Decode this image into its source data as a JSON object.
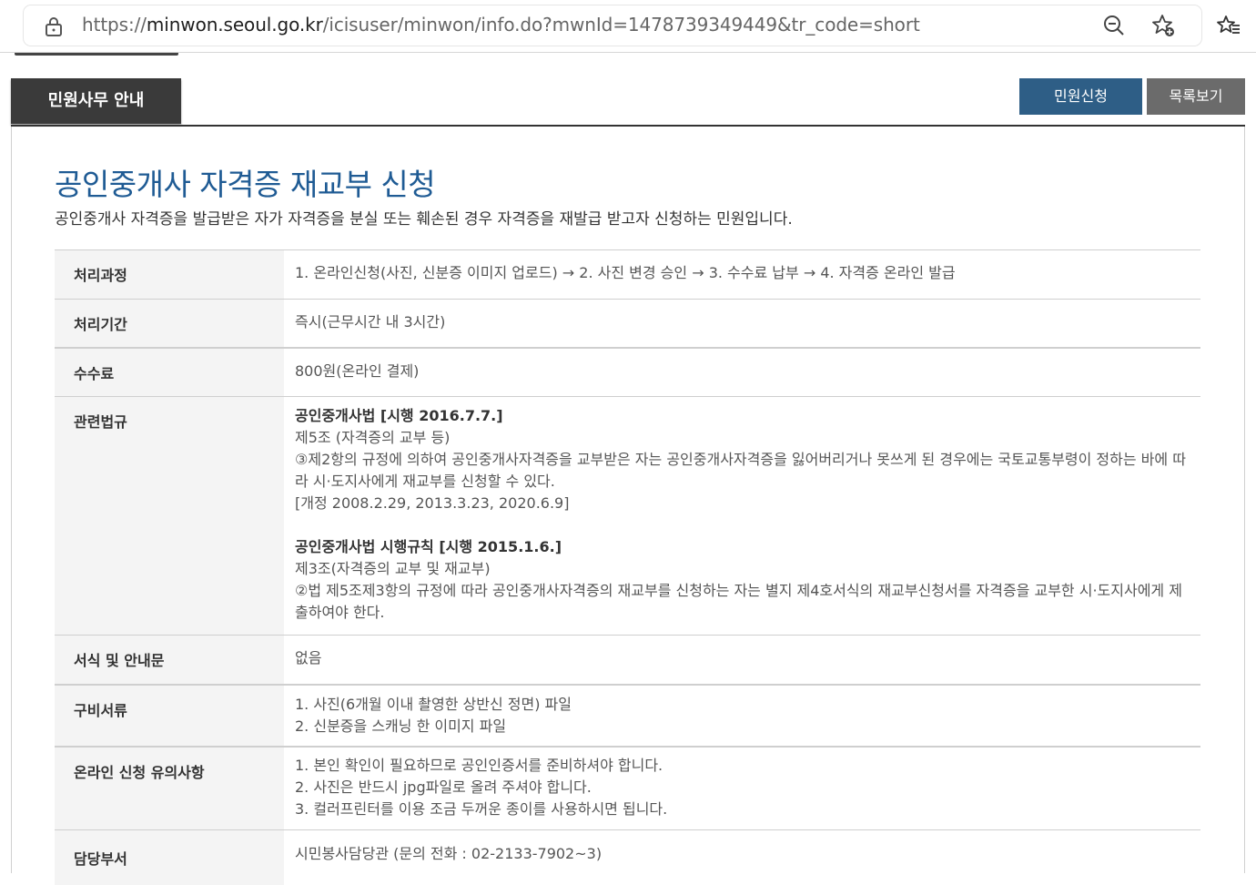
{
  "browser": {
    "url_prefix": "https://",
    "url_host": "minwon.seoul.go.kr",
    "url_rest": "/icisuser/minwon/info.do?mwnId=1478739349449&tr_code=short"
  },
  "header": {
    "tab_title": "민원사무 안내",
    "apply_button": "민원신청",
    "list_button": "목록보기"
  },
  "main": {
    "title": "공인중개사 자격증 재교부 신청",
    "description": "공인중개사 자격증을 발급받은 자가 자격증을 분실 또는 훼손된 경우 자격증을 재발급 받고자 신청하는 민원입니다."
  },
  "table": {
    "process": {
      "label": "처리과정",
      "value": "1. 온라인신청(사진, 신분증 이미지 업로드) → 2. 사진 변경 승인 → 3. 수수료 납부 → 4. 자격증 온라인 발급"
    },
    "period": {
      "label": "처리기간",
      "value": "즉시(근무시간 내 3시간)"
    },
    "fee": {
      "label": "수수료",
      "value": "800원(온라인 결제)"
    },
    "law": {
      "label": "관련법규",
      "law1_title": "공인중개사법 [시행 2016.7.7.]",
      "law1_article": "제5조 (자격증의 교부 등)",
      "law1_text": "③제2항의 규정에 의하여 공인중개사자격증을 교부받은 자는 공인중개사자격증을 잃어버리거나 못쓰게 된 경우에는 국토교통부령이 정하는 바에 따라 시·도지사에게 재교부를 신청할 수 있다.",
      "law1_amend": "[개정 2008.2.29, 2013.3.23, 2020.6.9]",
      "law2_title": "공인중개사법 시행규칙 [시행 2015.1.6.]",
      "law2_article": "제3조(자격증의 교부 및 재교부)",
      "law2_text": "②법 제5조제3항의 규정에 따라 공인중개사자격증의 재교부를 신청하는 자는 별지 제4호서식의 재교부신청서를 자격증을 교부한 시·도지사에게 제출하여야 한다."
    },
    "forms": {
      "label": "서식 및 안내문",
      "value": "없음"
    },
    "docs": {
      "label": "구비서류",
      "items": [
        "1. 사진(6개월 이내 촬영한 상반신 정면) 파일",
        "2. 신분증을 스캐닝 한 이미지 파일"
      ]
    },
    "notes": {
      "label": "온라인 신청 유의사항",
      "items": [
        "1. 본인 확인이 필요하므로 공인인증서를 준비하셔야 합니다.",
        "2. 사진은 반드시 jpg파일로 올려 주셔야 합니다.",
        "3. 컬러프린터를 이용 조금 두꺼운 종이를 사용하시면 됩니다."
      ]
    },
    "dept": {
      "label": "담당부서",
      "value": "시민봉사담당관 (문의 전화 : 02-2133-7902~3)"
    }
  }
}
